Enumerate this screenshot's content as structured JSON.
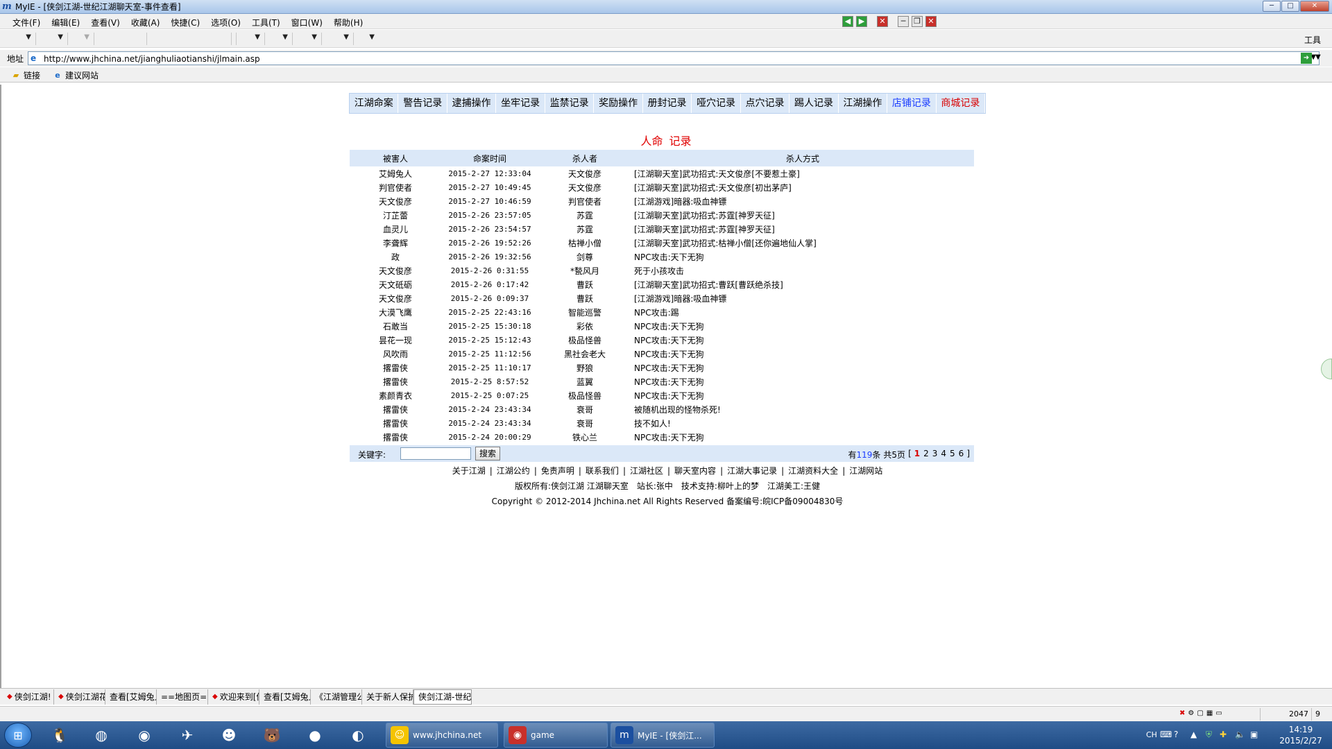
{
  "window": {
    "app_name": "MyIE",
    "title": "MyIE - [侠剑江湖-世纪江湖聊天室-事件查看]",
    "controls": [
      "─",
      "□",
      "✕"
    ]
  },
  "menu": {
    "items": [
      "文件(F)",
      "编辑(E)",
      "查看(V)",
      "收藏(A)",
      "快捷(C)",
      "选项(O)",
      "工具(T)",
      "窗口(W)",
      "帮助(H)"
    ]
  },
  "toolbar": {
    "tools_label": "工具"
  },
  "address": {
    "label": "地址",
    "url": "http://www.jhchina.net/jianghuliaotianshi/jlmain.asp"
  },
  "links": {
    "items": [
      {
        "label": "链接",
        "icon": "folder-icon"
      },
      {
        "label": "建议网站",
        "icon": "ie-icon"
      }
    ]
  },
  "page": {
    "nav": [
      {
        "label": "江湖命案",
        "color": ""
      },
      {
        "label": "警告记录",
        "color": ""
      },
      {
        "label": "逮捕操作",
        "color": ""
      },
      {
        "label": "坐牢记录",
        "color": ""
      },
      {
        "label": "监禁记录",
        "color": ""
      },
      {
        "label": "奖励操作",
        "color": ""
      },
      {
        "label": "册封记录",
        "color": ""
      },
      {
        "label": "哑穴记录",
        "color": ""
      },
      {
        "label": "点穴记录",
        "color": ""
      },
      {
        "label": "踢人记录",
        "color": ""
      },
      {
        "label": "江湖操作",
        "color": ""
      },
      {
        "label": "店铺记录",
        "color": "blue"
      },
      {
        "label": "商城记录",
        "color": "red"
      }
    ],
    "heading_left": "人命",
    "heading_right": "记录",
    "table": {
      "headers": [
        "被害人",
        "命案时间",
        "杀人者",
        "杀人方式"
      ],
      "rows": [
        [
          "艾姆兔人",
          "2015-2-27 12:33:04",
          "天文俊彦",
          "[江湖聊天室]武功招式:天文俊彦[不要惹土豪]"
        ],
        [
          "判官使者",
          "2015-2-27 10:49:45",
          "天文俊彦",
          "[江湖聊天室]武功招式:天文俊彦[初出茅庐]"
        ],
        [
          "天文俊彦",
          "2015-2-27 10:46:59",
          "判官使者",
          "[江湖游戏]暗器:吸血神镖"
        ],
        [
          "汀芷蕾",
          "2015-2-26 23:57:05",
          "苏霆",
          "[江湖聊天室]武功招式:苏霆[神罗天征]"
        ],
        [
          "血灵儿",
          "2015-2-26 23:54:57",
          "苏霆",
          "[江湖聊天室]武功招式:苏霆[神罗天征]"
        ],
        [
          "李聋辉",
          "2015-2-26 19:52:26",
          "枯禅小僧",
          "[江湖聊天室]武功招式:枯禅小僧[还你遍地仙人掌]"
        ],
        [
          "政",
          "2015-2-26 19:32:56",
          "剑尊",
          "NPC攻击:天下无狗"
        ],
        [
          "天文俊彦",
          "2015-2-26 0:31:55",
          "*甃风月",
          "死于小孩攻击"
        ],
        [
          "天文砥砺",
          "2015-2-26 0:17:42",
          "曹跃",
          "[江湖聊天室]武功招式:曹跃[曹跃绝杀技]"
        ],
        [
          "天文俊彦",
          "2015-2-26 0:09:37",
          "曹跃",
          "[江湖游戏]暗器:吸血神镖"
        ],
        [
          "大漠飞鹰",
          "2015-2-25 22:43:16",
          "智能巡警",
          "NPC攻击:踢"
        ],
        [
          "石敢当",
          "2015-2-25 15:30:18",
          "彩依",
          "NPC攻击:天下无狗"
        ],
        [
          "昙花一现",
          "2015-2-25 15:12:43",
          "极品怪兽",
          "NPC攻击:天下无狗"
        ],
        [
          "风吹雨",
          "2015-2-25 11:12:56",
          "黑社会老大",
          "NPC攻击:天下无狗"
        ],
        [
          "撂雷侠",
          "2015-2-25 11:10:17",
          "野狼",
          "NPC攻击:天下无狗"
        ],
        [
          "撂雷侠",
          "2015-2-25 8:57:52",
          "蓝翼",
          "NPC攻击:天下无狗"
        ],
        [
          "素颜青衣",
          "2015-2-25 0:07:25",
          "极品怪兽",
          "NPC攻击:天下无狗"
        ],
        [
          "撂雷侠",
          "2015-2-24 23:43:34",
          "衰哥",
          "被随机出现的怪物杀死!"
        ],
        [
          "撂雷侠",
          "2015-2-24 23:43:34",
          "衰哥",
          "技不如人!"
        ],
        [
          "撂雷侠",
          "2015-2-24 20:00:29",
          "铁心兰",
          "NPC攻击:天下无狗"
        ]
      ]
    },
    "search": {
      "keyword_label": "关键字:",
      "input_value": "",
      "button_label": "搜索",
      "count_prefix": "有",
      "count": "119",
      "count_suffix": "条",
      "pages_label": "共5页",
      "bracket_open": "[",
      "pages": [
        "1",
        "2",
        "3",
        "4",
        "5",
        "6"
      ],
      "current_page": "1",
      "bracket_close": "]"
    },
    "footer_links": [
      "关于江湖",
      "江湖公约",
      "免责声明",
      "联系我们",
      "江湖社区",
      "聊天室内容",
      "江湖大事记录",
      "江湖资料大全",
      "江湖网站"
    ],
    "footer_credits": [
      "版权所有:侠剑江湖 江湖聊天室",
      "站长:张中",
      "技术支持:柳叶上的梦",
      "江湖美工:王健"
    ],
    "copyright": "Copyright © 2012-2014 Jhchina.net All Rights Reserved 备案编号:皖ICP备09004830号"
  },
  "tabs": [
    {
      "label": "侠剑江湖!",
      "dot": true
    },
    {
      "label": "侠剑江湖花[",
      "dot": true
    },
    {
      "label": "查看[艾姆兔人",
      "dot": false
    },
    {
      "label": "==地图页==(",
      "dot": false
    },
    {
      "label": "欢迎来到[侠",
      "dot": true
    },
    {
      "label": "查看[艾姆兔人",
      "dot": false
    },
    {
      "label": "《江湖管理公",
      "dot": false
    },
    {
      "label": "关于新人保护",
      "dot": false
    },
    {
      "label": "侠剑江湖-世纪",
      "dot": false,
      "active": true
    }
  ],
  "status": {
    "value1": "2047",
    "value2": "9"
  },
  "taskbar": {
    "tasks": [
      {
        "label": "www.jhchina.net",
        "icon": "monkey-icon"
      },
      {
        "label": "game",
        "icon": "game-icon"
      },
      {
        "label": "MyIE - [侠剑江...",
        "icon": "myie-icon"
      }
    ],
    "tray_lang": "CH",
    "time": "14:19",
    "date": "2015/2/27"
  },
  "colors": {
    "accent_blue": "#dbe8f8",
    "heading_red": "#e00000",
    "link_blue": "#1a3cff",
    "taskbar": "#1f4c85"
  }
}
